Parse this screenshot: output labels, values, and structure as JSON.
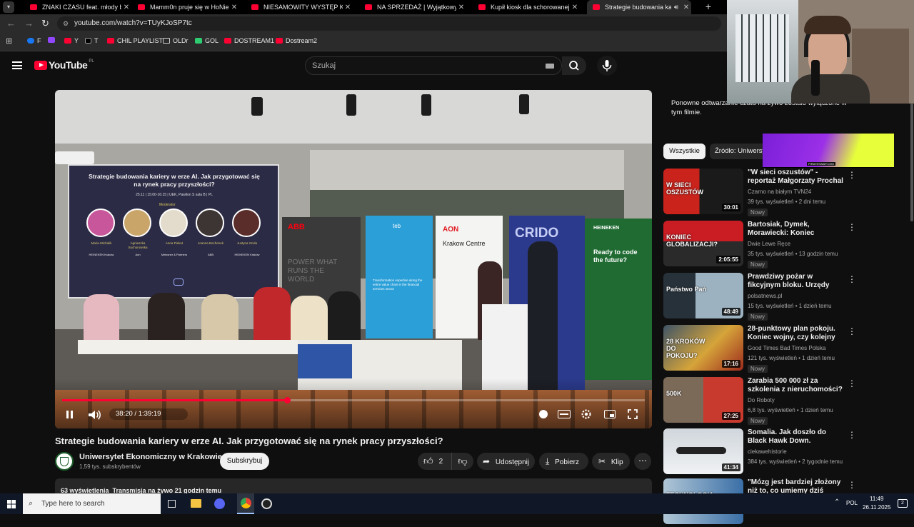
{
  "tabs": [
    {
      "title": "ZNAKI CZASU feat. młody będę",
      "active": false
    },
    {
      "title": "Mamm0n pruje się w HoNie, pr",
      "active": false
    },
    {
      "title": "NIESAMOWITY WYSTĘP KOCHA",
      "active": false
    },
    {
      "title": "NA SPRZEDAŻ | Wyjątkowy apa",
      "active": false
    },
    {
      "title": "Kupił kiosk dla schorowanej żo",
      "active": false
    },
    {
      "title": "Strategie budowania kariery",
      "active": true
    }
  ],
  "new_tab_label": "+",
  "url": "youtube.com/watch?v=TUyKJoSP7tc",
  "bookmarks": [
    "F",
    "",
    "Y",
    "T",
    "CHIL PLAYLIST",
    "OLDr",
    "GOL",
    "DOSTREAM1",
    "Dostream2"
  ],
  "youtube": {
    "logo_text": "YouTube",
    "region": "PL",
    "search_placeholder": "Szukaj"
  },
  "player": {
    "slide_title": "Strategie budowania kariery w erze AI. Jak przygotować się na rynek pracy przyszłości?",
    "slide_info": "25.11 | 15:00-16:15 | UEK, Pawilon S sala B | PL",
    "slide_moderator": "Moderator",
    "speakers": [
      {
        "name": "Maria Michalik",
        "org": "HEINEKEN Kraków"
      },
      {
        "name": "Agnieszka Suchorowska",
        "org": "Aon"
      },
      {
        "name": "Anna Piekut",
        "org": "Meissner & Partners"
      },
      {
        "name": "Joanna Bochenek",
        "org": "ABB"
      },
      {
        "name": "Justyna Szula",
        "org": "HEINEKEN Kraków"
      }
    ],
    "banners": {
      "abb": "ABB",
      "abb_tagline": "POWER WHAT RUNS THE WORLD",
      "teb": "teb",
      "teb_tagline": "Transformation expertise along the entire value chain in the financial services sector",
      "aon": "AON",
      "aon_sub": "Krakow Centre",
      "crido": "CRIDO",
      "heineken": "HEINEKEN",
      "heineken_tagline": "Ready to code the future?"
    },
    "time": "38:20 / 1:39:19",
    "progress": 0.386
  },
  "video": {
    "title": "Strategie budowania kariery w erze AI. Jak przygotować się na rynek pracy przyszłości?",
    "channel": "Uniwersytet Ekonomiczny w Krakowie",
    "subscribers": "1,59 tys. subskrybentów",
    "subscribe_label": "Subskrybuj",
    "likes": "2",
    "share_label": "Udostępnij",
    "download_label": "Pobierz",
    "clip_label": "Klip",
    "description_meta": "63 wyświetlenia  Transmisja na żywo 21 godzin temu"
  },
  "sidebar": {
    "chat_notice": "Ponowne odtwarzanie czatu na żywo zostało wyłączone w tym filmie.",
    "chips": [
      "Wszystkie",
      "Źródło: Uniwersy"
    ],
    "videos": [
      {
        "title": "\"W sieci oszustów\" - reportaż Małgorzaty Prochal [Czarno n...",
        "channel": "Czarno na białym TVN24",
        "meta": "39 tys. wyświetleń • 2 dni temu",
        "badge": "Nowy",
        "duration": "30:01",
        "thumb_text": "W SIECI OSZUSTÓW"
      },
      {
        "title": "Bartosiak, Dymek, Morawiecki: Koniec globalizacji i „Punkty ...",
        "channel": "Dwie Lewe Ręce",
        "meta": "35 tys. wyświetleń • 13 godzin temu",
        "badge": "Nowy",
        "duration": "2:05:55",
        "thumb_text": "KONIEC GLOBALIZACJI?"
      },
      {
        "title": "Prawdziwy pożar w fikcyjnym bloku. Urzędy umywają ręce",
        "channel": "polsatnews.pl",
        "meta": "15 tys. wyświetleń • 1 dzień temu",
        "badge": "Nowy",
        "duration": "48:49",
        "thumb_text": "Państwo Pań"
      },
      {
        "title": "28-punktowy plan pokoju. Koniec wojny, czy kolejny blef?",
        "channel": "Good Times Bad Times Polska",
        "meta": "121 tys. wyświetleń • 1 dzień temu",
        "badge": "Nowy",
        "duration": "17:16",
        "thumb_text": "28 KROKÓW DO POKOJU?"
      },
      {
        "title": "Zarabia 500 000 zł za szkolenia z nieruchomości? Daniel Siwie...",
        "channel": "Do Roboty",
        "meta": "6,8 tys. wyświetleń • 1 dzień temu",
        "badge": "Nowy",
        "duration": "27:25",
        "thumb_text": "500K"
      },
      {
        "title": "Somalia. Jak doszło do Black Hawk Down.",
        "channel": "ciekawehistorie",
        "meta": "384 tys. wyświetleń • 2 tygodnie temu",
        "badge": "",
        "duration": "41:34",
        "thumb_text": ""
      },
      {
        "title": "\"Mózg jest bardziej złożony niż to, co umiemy dziś tworzyć\" - ...",
        "channel": "",
        "meta": "",
        "badge": "",
        "duration": "",
        "thumb_text": "TECHNOLOGIA"
      }
    ]
  },
  "overlay": {
    "ad_text": "PIRATESWAP.COM"
  },
  "taskbar": {
    "search_placeholder": "Type here to search",
    "language": "POL",
    "time": "11:49",
    "date": "26.11.2025",
    "notifications": "2"
  }
}
